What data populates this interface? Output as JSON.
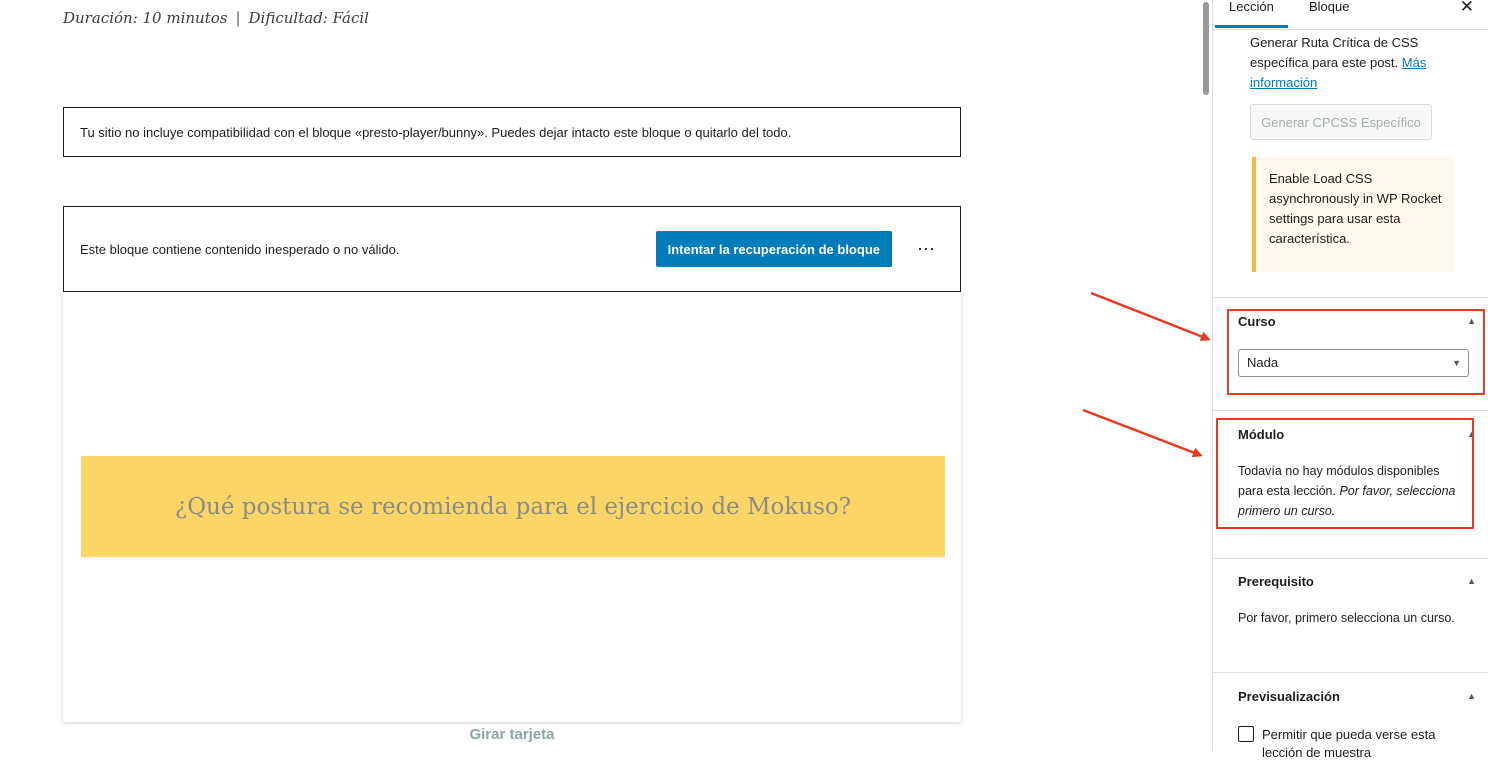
{
  "meta": {
    "duration": "Duración: 10 minutos",
    "separator": "|",
    "difficulty": "Dificultad: Fácil"
  },
  "editor": {
    "unsupported_notice": "Tu sitio no incluye compatibilidad con el bloque «presto-player/bunny». Puedes dejar intacto este bloque o quitarlo del todo.",
    "invalid_notice": "Este bloque contiene contenido inesperado o no válido.",
    "recover_button": "Intentar la recuperación de bloque",
    "more_button": "⋯",
    "card_question": "¿Qué postura se recomienda para el ejercicio de Mokuso?",
    "flip_label": "Girar tarjeta"
  },
  "sidebar": {
    "tabs": [
      {
        "label": "Lección",
        "active": true
      },
      {
        "label": "Bloque",
        "active": false
      }
    ],
    "close": "✕",
    "cpcss": {
      "text": "Generar Ruta Crítica de CSS específica para este post.",
      "link": "Más información",
      "button": "Generar CPCSS Específico",
      "warning": "Enable Load CSS asynchronously in WP Rocket settings para usar esta característica."
    },
    "curso": {
      "title": "Curso",
      "selected": "Nada"
    },
    "modulo": {
      "title": "Módulo",
      "text": "Todavía no hay módulos disponibles para esta lección.",
      "text_italic": "Por favor, selecciona primero un curso."
    },
    "prerequisito": {
      "title": "Prerequisito",
      "text": "Por favor, primero selecciona un curso."
    },
    "previsualizacion": {
      "title": "Previsualización",
      "checkbox_label": "Permitir que pueda verse esta lección de muestra"
    },
    "caret": "▲",
    "select_caret": "▼"
  },
  "colors": {
    "primary": "#007cba",
    "card_yellow": "#fbd565",
    "warning_border": "#f0b849",
    "annotation_red": "#e8391f"
  }
}
